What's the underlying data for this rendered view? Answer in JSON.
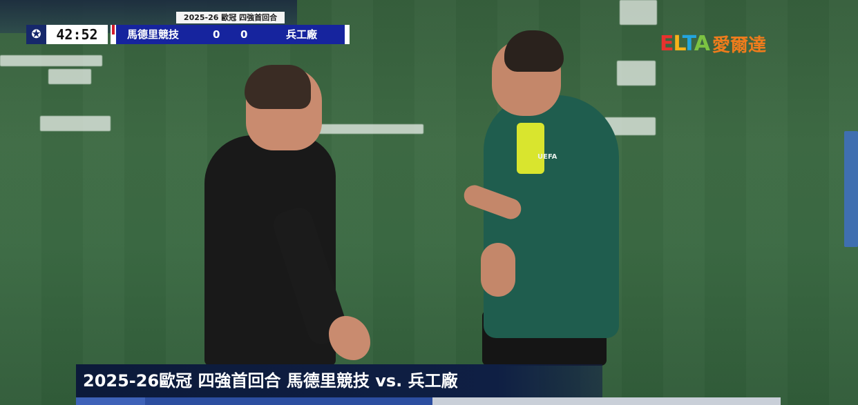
{
  "scoreboard": {
    "competition": "2025-26 歐冠 四強首回合",
    "clock": "42:52",
    "home_team": "馬德里競技",
    "home_score": "0",
    "away_score": "0",
    "away_team": "兵工廠",
    "logo_icon": "champions-league-star-ball-icon",
    "home_color": "#d31b2d",
    "bar_color": "#16249e"
  },
  "broadcaster": {
    "letters": [
      "E",
      "L",
      "T",
      "A"
    ],
    "chinese": "愛爾達"
  },
  "referee": {
    "badge": "UEFA"
  },
  "caption": {
    "text": "2025-26歐冠 四強首回合 馬德里競技 vs. 兵工廠"
  }
}
